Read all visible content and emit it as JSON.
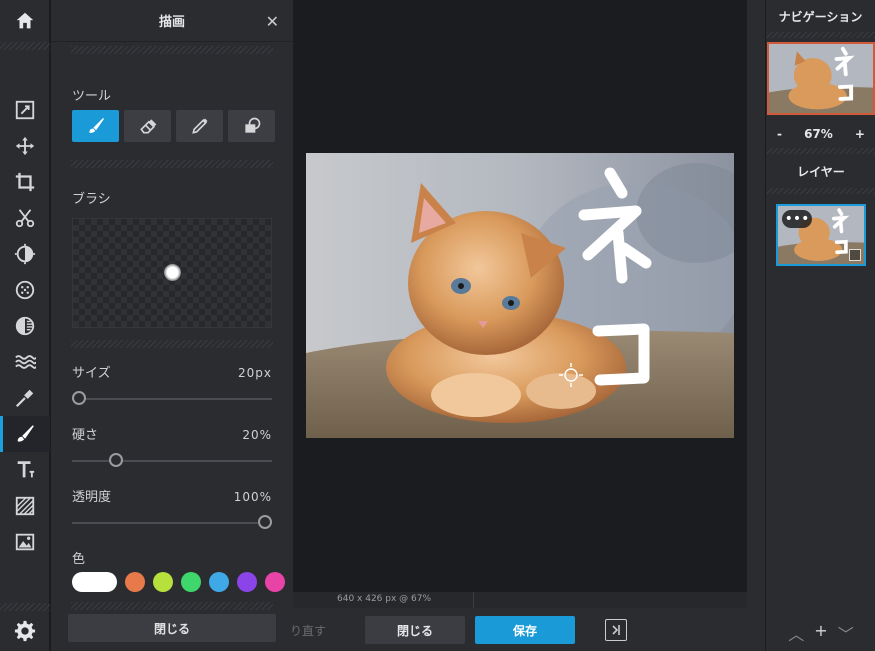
{
  "panel": {
    "title": "描画",
    "close_glyph": "✕",
    "tools_label": "ツール",
    "brush_label": "ブラシ",
    "size": {
      "label": "サイズ",
      "value": "20px",
      "fraction": 0.0
    },
    "hardness": {
      "label": "硬さ",
      "value": "20%",
      "fraction": 0.2
    },
    "opacity": {
      "label": "透明度",
      "value": "100%",
      "fraction": 1.0
    },
    "color_label": "色",
    "colors": [
      "#ffffff",
      "#e8794a",
      "#b6e03c",
      "#3fd66b",
      "#3fa9e8",
      "#8a44e8",
      "#e844a8"
    ],
    "close_button": "閉じる"
  },
  "canvas": {
    "dims": "640 x 426 px @ 67%",
    "overlay_text": [
      "ネ",
      "コ"
    ]
  },
  "bottom_bar": {
    "redo": "り直す",
    "close": "閉じる",
    "save": "保存"
  },
  "navigation": {
    "title": "ナビゲーション",
    "zoom_minus": "-",
    "zoom": "67%",
    "zoom_plus": "+"
  },
  "layers": {
    "title": "レイヤー",
    "menu_dots": "•••"
  },
  "layer_controls": {
    "up": "︿",
    "add": "+",
    "down": "﹀"
  },
  "colors": {
    "accent": "#1a9ad6",
    "panel_bg": "#2a2c30",
    "canvas_bg": "#1b1c1f"
  }
}
